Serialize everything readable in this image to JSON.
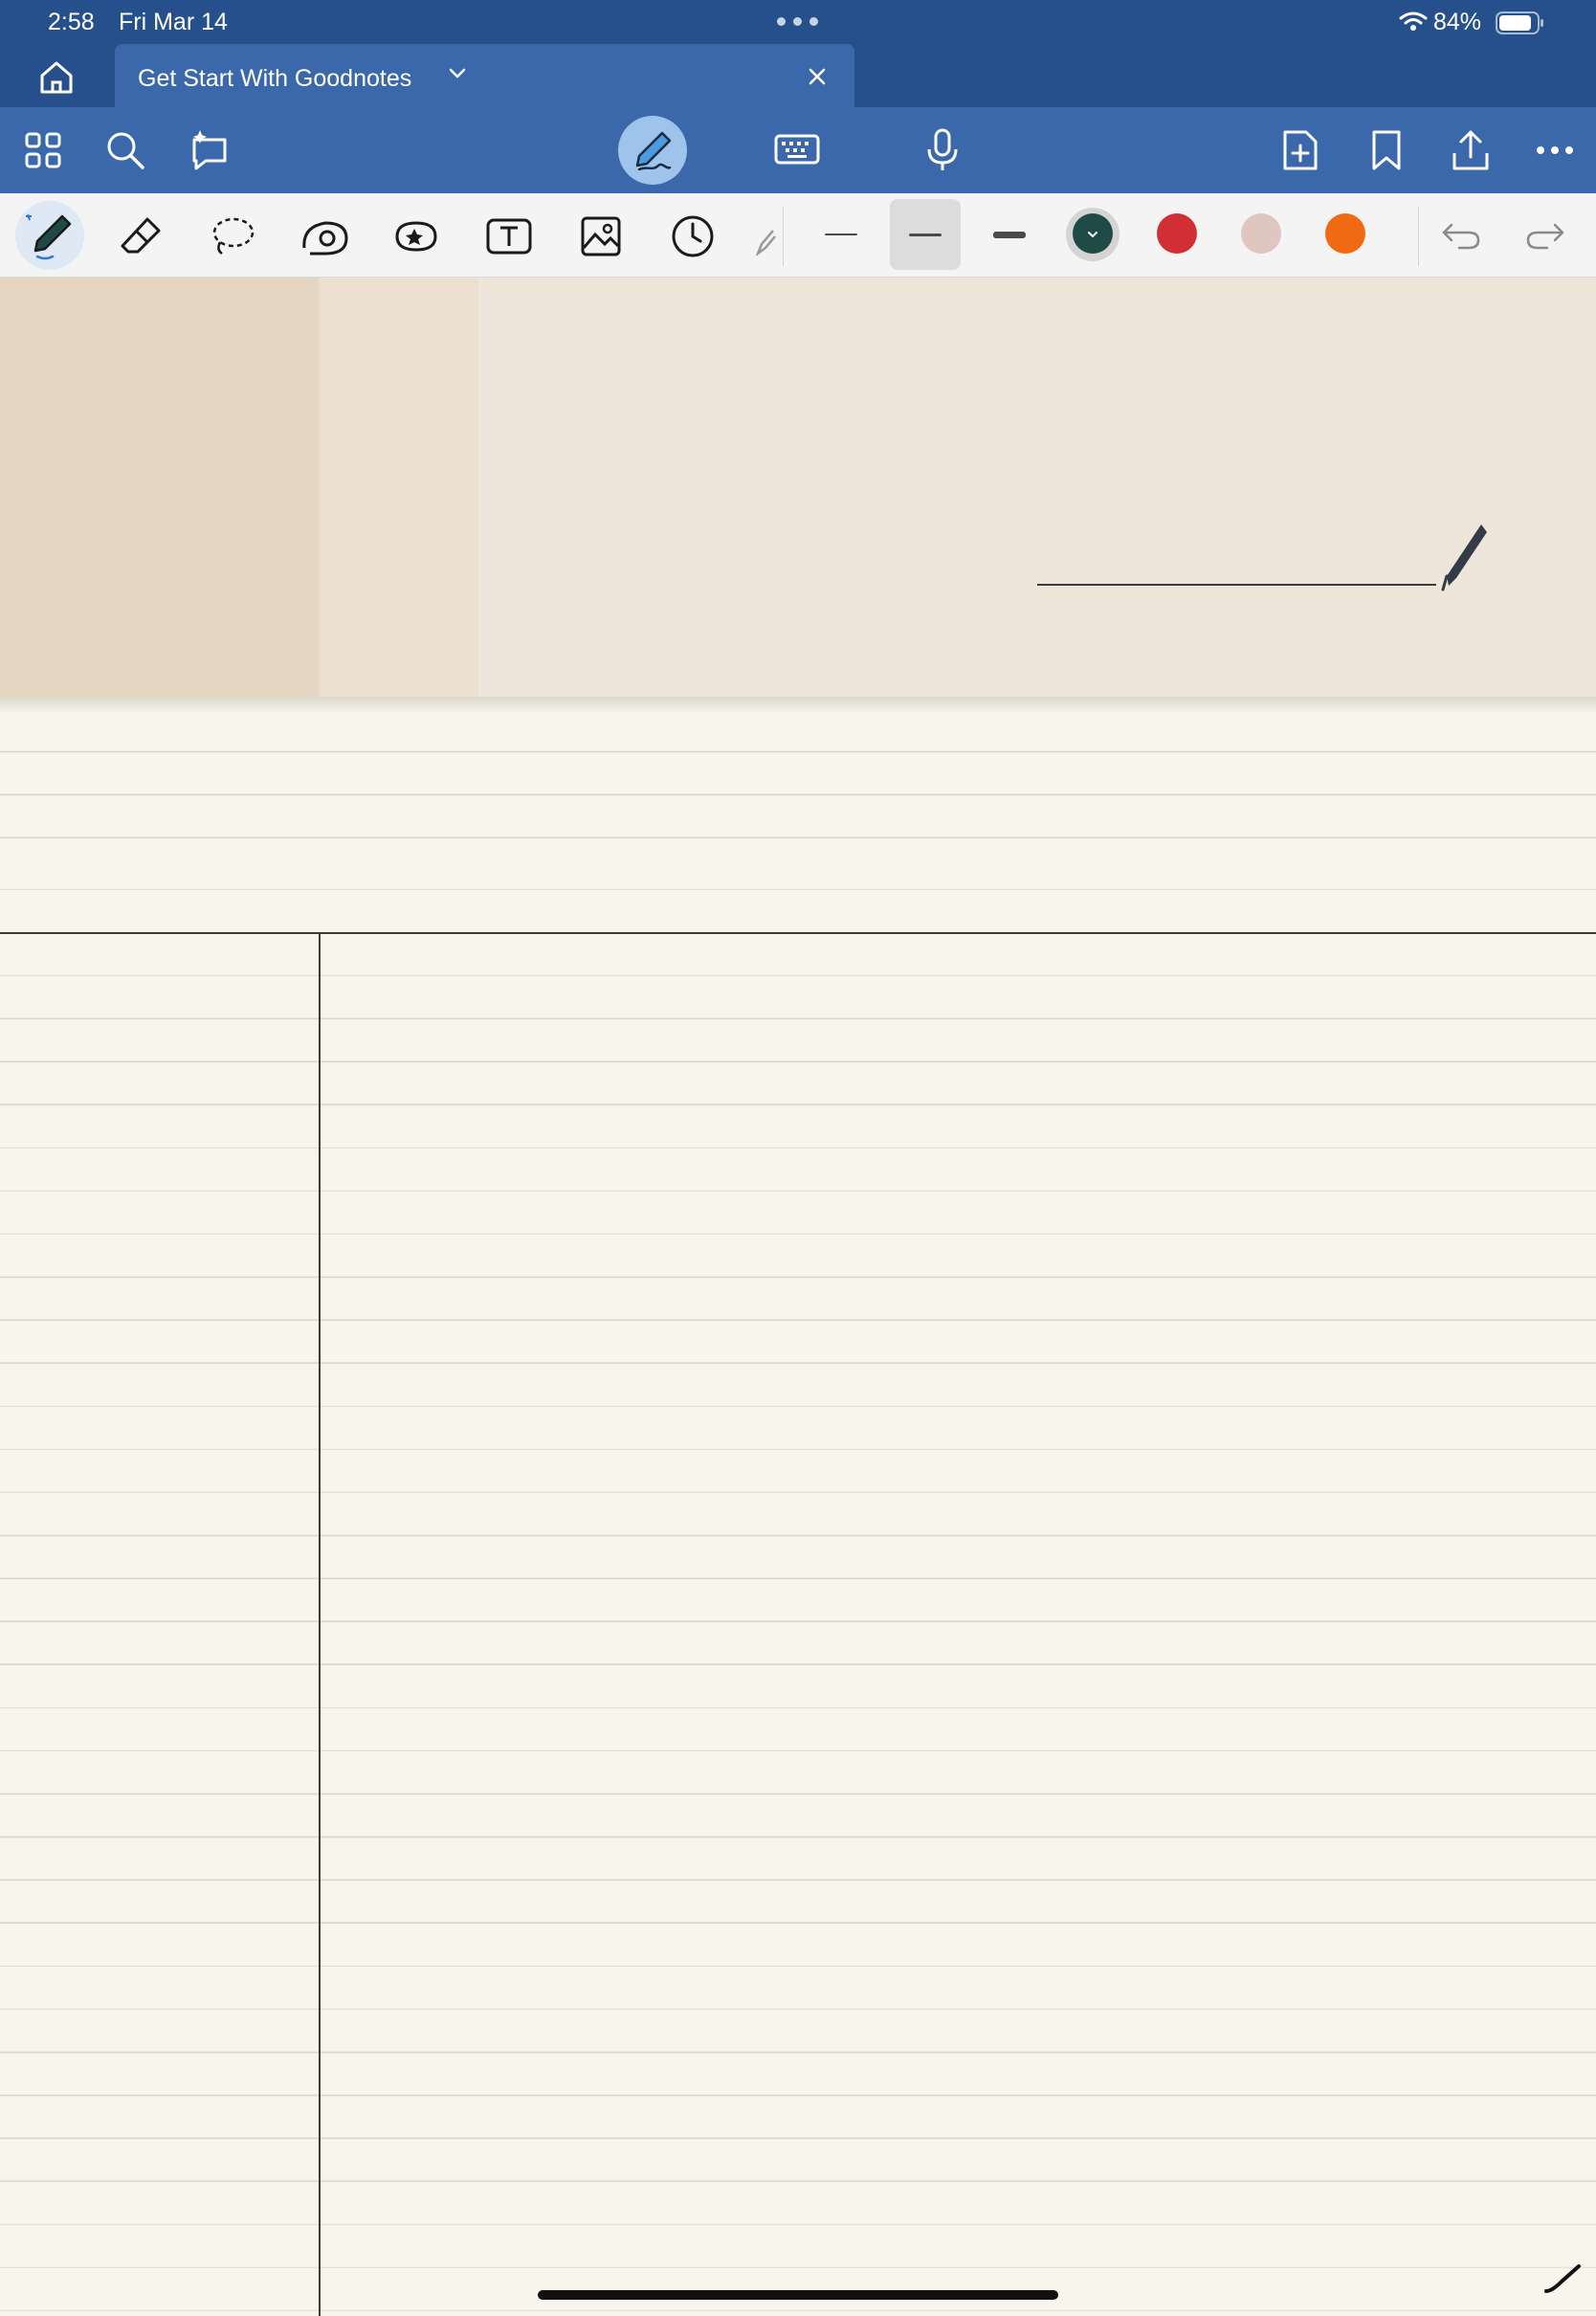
{
  "status_bar": {
    "time": "2:58",
    "date": "Fri Mar 14",
    "battery": "84%"
  },
  "tab": {
    "title": "Get Start With Goodnotes"
  },
  "main_toolbar": {
    "left": [
      "grid-icon",
      "search-icon",
      "ai-assist-icon"
    ],
    "center": [
      "pen-mode-icon",
      "keyboard-icon",
      "microphone-icon"
    ],
    "right": [
      "add-page-icon",
      "bookmark-icon",
      "share-icon",
      "more-icon"
    ]
  },
  "tools": [
    "pen",
    "eraser",
    "lasso",
    "shapes",
    "stickers",
    "text",
    "image",
    "timer",
    "highlighter"
  ],
  "stroke_sizes": [
    "thin",
    "medium",
    "thick"
  ],
  "selected_stroke": "medium",
  "colors": {
    "accent_bar": "#26508c",
    "toolbar": "#3a68aa",
    "swatches": [
      "#1f4a45",
      "#d22f35",
      "#e0c6c1",
      "#ef6a10"
    ],
    "selected_swatch": "#1f4a45"
  }
}
